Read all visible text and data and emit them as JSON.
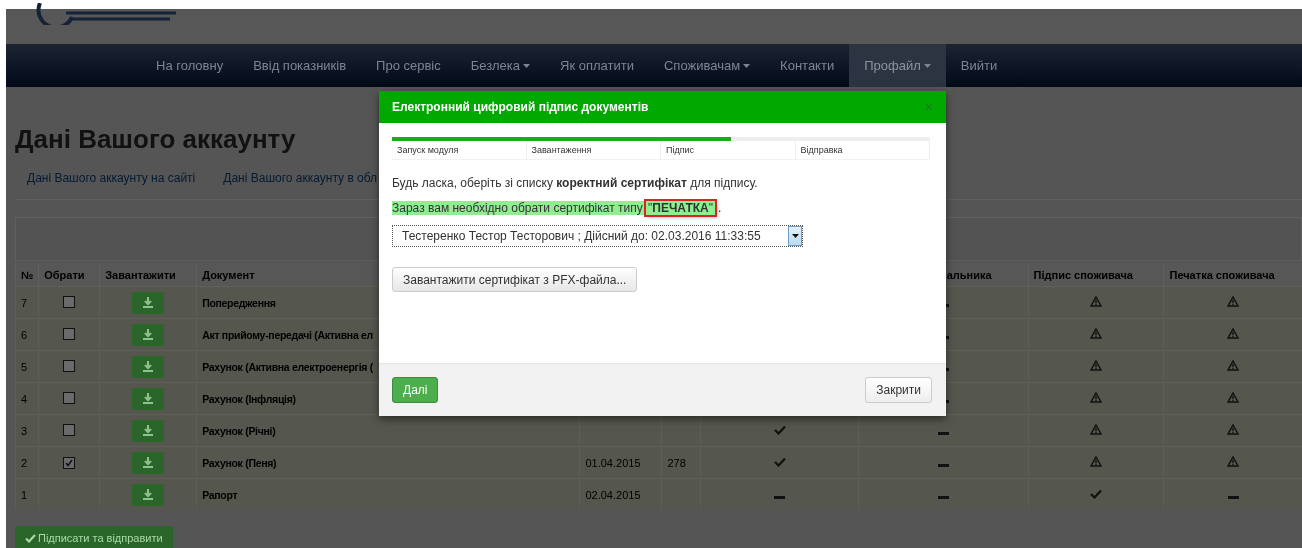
{
  "nav": {
    "items": [
      {
        "label": "На головну",
        "dropdown": false,
        "selected": false
      },
      {
        "label": "Ввід показників",
        "dropdown": false,
        "selected": false
      },
      {
        "label": "Про сервіс",
        "dropdown": false,
        "selected": false
      },
      {
        "label": "Безлека",
        "dropdown": true,
        "selected": false
      },
      {
        "label": "Як оплатити",
        "dropdown": false,
        "selected": false
      },
      {
        "label": "Споживачам",
        "dropdown": true,
        "selected": false
      },
      {
        "label": "Контакти",
        "dropdown": false,
        "selected": false
      },
      {
        "label": "Профайл",
        "dropdown": true,
        "selected": true
      },
      {
        "label": "Вийти",
        "dropdown": false,
        "selected": false
      }
    ]
  },
  "page_title": "Дані Вашого аккаунту",
  "tabs": [
    {
      "label": "Дані Вашого аккаунту на сайті",
      "selected": false
    },
    {
      "label": "Дані Вашого аккаунту в обл",
      "selected": false
    }
  ],
  "table": {
    "columns": [
      {
        "label": "№"
      },
      {
        "label": "Обрати"
      },
      {
        "label": "Завантажити"
      },
      {
        "label": "Документ"
      },
      {},
      {},
      {},
      {
        "label": "альника"
      },
      {
        "label": "Підпис споживача"
      },
      {
        "label": "Печатка споживача"
      }
    ],
    "rows": [
      {
        "number": "7",
        "checked": false,
        "document": "Попередження",
        "marks": [
          {
            "kind": "dash"
          },
          {
            "kind": "warning"
          },
          {
            "kind": "warning"
          }
        ]
      },
      {
        "number": "6",
        "checked": false,
        "document": "Акт прийому-передачі (Активна ел",
        "marks": [
          {
            "kind": "dash"
          },
          {
            "kind": "warning"
          },
          {
            "kind": "warning"
          }
        ]
      },
      {
        "number": "5",
        "checked": false,
        "document": "Рахунок (Активна електроенергія (",
        "marks": [
          {
            "kind": "dash"
          },
          {
            "kind": "warning"
          },
          {
            "kind": "warning"
          }
        ]
      },
      {
        "number": "4",
        "checked": false,
        "document": "Рахунок (Інфляція)",
        "marks": [
          {
            "kind": "dash"
          },
          {
            "kind": "warning"
          },
          {
            "kind": "warning"
          }
        ]
      },
      {
        "number": "3",
        "checked": false,
        "document": "Рахунок (Річні)",
        "marks": [
          {
            "kind": "check"
          },
          {
            "kind": "dash"
          },
          {
            "kind": "warning"
          },
          {
            "kind": "warning"
          }
        ]
      },
      {
        "number": "2",
        "checked": true,
        "document": "Рахунок (Пеня)",
        "column_5": "01.04.2015",
        "column_6": "278",
        "marks": [
          {
            "kind": "check"
          },
          {
            "kind": "dash"
          },
          {
            "kind": "warning"
          },
          {
            "kind": "warning"
          }
        ]
      },
      {
        "number": "1",
        "document": "Рапорт",
        "column_5": "02.04.2015",
        "marks": [
          {
            "kind": "dash"
          },
          {
            "kind": "dash"
          },
          {
            "kind": "check"
          },
          {
            "kind": "dash"
          }
        ]
      }
    ]
  },
  "sign_button": "Підписати та відправити",
  "modal": {
    "title": "Електронний цифровий підпис документів",
    "close": "×",
    "progress": {
      "level": 0.63
    },
    "steps": [
      "Запуск модуля",
      "Завантаження",
      "Підпис",
      "Відправка"
    ],
    "instruction": "Будь ласка, оберіть зі списку **коректний сертифікат** для підпису.",
    "notice": {
      "text": "Зараз вам необхідно обрати сертифікат типу ",
      "emphasis": "\"**ПЕЧАТКА**\"",
      "end": "."
    },
    "certificate_select": {
      "value": "Тестеренко Тестор Тесторович ; Дійсний до: 02.03.2016 11:33:55"
    },
    "pfx_button": "Завантажити сертифікат з PFX-файла...",
    "next_button": "Далі",
    "close_button": "Закрити"
  }
}
